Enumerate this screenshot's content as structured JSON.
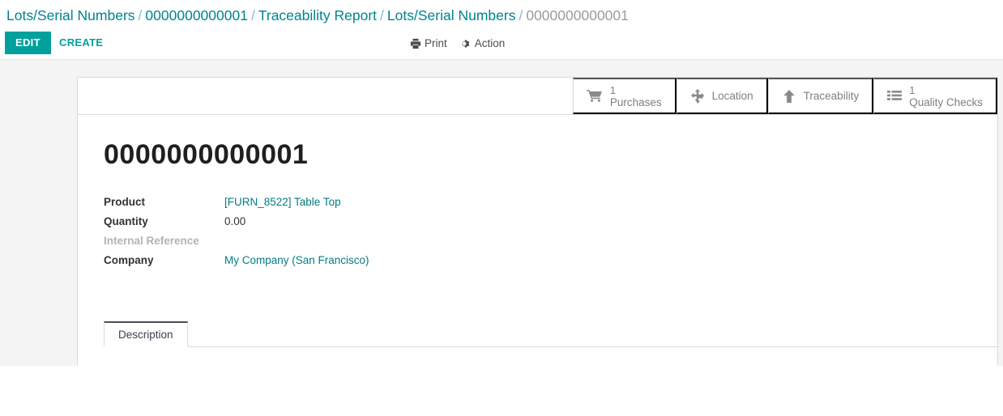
{
  "breadcrumb": {
    "items": [
      {
        "label": "Lots/Serial Numbers",
        "current": false
      },
      {
        "label": "0000000000001",
        "current": false
      },
      {
        "label": "Traceability Report",
        "current": false
      },
      {
        "label": "Lots/Serial Numbers",
        "current": false
      },
      {
        "label": "0000000000001",
        "current": true
      }
    ],
    "separator": "/"
  },
  "control_panel": {
    "edit_label": "EDIT",
    "create_label": "CREATE",
    "print_label": "Print",
    "action_label": "Action"
  },
  "stat_buttons": [
    {
      "icon": "shopping-cart-icon",
      "value": "1",
      "label": "Purchases"
    },
    {
      "icon": "arrows-move-icon",
      "value": "",
      "label": "Location"
    },
    {
      "icon": "arrow-up-icon",
      "value": "",
      "label": "Traceability"
    },
    {
      "icon": "list-icon",
      "value": "1",
      "label": "Quality Checks"
    }
  ],
  "record": {
    "title": "0000000000001",
    "fields": [
      {
        "label": "Product",
        "value": "[FURN_8522] Table Top",
        "link": true,
        "empty": false
      },
      {
        "label": "Quantity",
        "value": "0.00",
        "link": false,
        "empty": false
      },
      {
        "label": "Internal Reference",
        "value": "",
        "link": false,
        "empty": true
      },
      {
        "label": "Company",
        "value": "My Company (San Francisco)",
        "link": true,
        "empty": false
      }
    ]
  },
  "notebook": {
    "tabs": [
      {
        "label": "Description",
        "active": true
      }
    ]
  },
  "colors": {
    "accent": "#00a09d",
    "link": "#017e84",
    "muted": "#9b9b9b",
    "stat_grey": "#7f7f7f",
    "border": "#d8dadd",
    "page_bg": "#f4f4f4"
  }
}
